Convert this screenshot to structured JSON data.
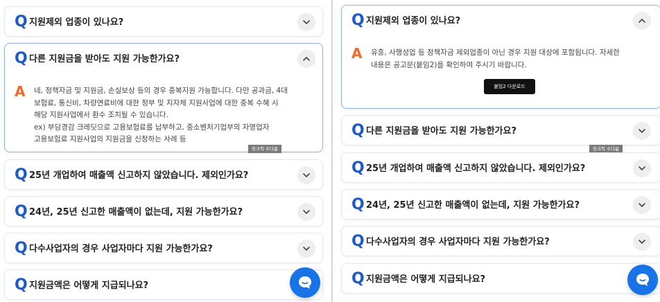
{
  "left_panel": {
    "items": [
      {
        "q": "Q",
        "question": "지원제외 업종이 있나요?",
        "open": false
      },
      {
        "q": "Q",
        "question": "다른 지원금을 받아도 지원 가능한가요?",
        "open": true,
        "a": "A",
        "answer_lines": [
          "네, 정책자금 및 지원금, 손실보상 등의 경우 중복지원 가능합니다. 다만 공과금, 4대",
          "보험료, 통신비, 차량연료비에 대한 정부 및 지자체 지원사업에 대한 중복 수혜 시",
          "해당 지원사업에서 환수 조치될 수 있습니다.",
          "ex) 부담경감 크레딧으로 고용보험료를 납부하고, 중소벤처기업부의 자영업자",
          "고용보험료 지원사업의 지원금을 신청하는 사례 등"
        ],
        "badge": "링크픽 수다름"
      },
      {
        "q": "Q",
        "question": "25년 개업하여 매출액 신고하지 않았습니다. 제외인가요?",
        "open": false
      },
      {
        "q": "Q",
        "question": "24년, 25년 신고한 매출액이 없는데, 지원 가능한가요?",
        "open": false
      },
      {
        "q": "Q",
        "question": "다수사업자의 경우 사업자마다 지원 가능한가요?",
        "open": false
      },
      {
        "q": "Q",
        "question": "지원금액은 어떻게 지급되나요?",
        "open": false
      }
    ]
  },
  "right_panel": {
    "items": [
      {
        "q": "Q",
        "question": "지원제외 업종이 있나요?",
        "open": true,
        "a": "A",
        "answer_lines": [
          "유흥, 사행성업 등 정책자금 제외업종이 아닌 경우 지원 대상에 포함됩니다. 자세한",
          "내용은 공고문(붙임2)을 확인하여 주시기 바랍니다."
        ],
        "button": "붙임2 다운로드"
      },
      {
        "q": "Q",
        "question": "다른 지원금을 받아도 지원 가능한가요?",
        "open": false
      },
      {
        "q": "Q",
        "question": "25년 개업하여 매출액 신고하지 않았습니다. 제외인가요?",
        "open": false
      },
      {
        "q": "Q",
        "question": "24년, 25년 신고한 매출액이 없는데, 지원 가능한가요?",
        "open": false
      },
      {
        "q": "Q",
        "question": "다수사업자의 경우 사업자마다 지원 가능한가요?",
        "open": false
      },
      {
        "q": "Q",
        "question": "지원금액은 어떻게 지급되나요?",
        "open": false
      }
    ],
    "badge": "링크픽 수다름"
  },
  "colors": {
    "q_blue": "#1f5bc4",
    "a_orange": "#ef6b2c",
    "chat_blue": "#1773e6"
  },
  "icons": {
    "expanded": "chevron-up-icon",
    "collapsed": "chevron-down-icon",
    "chat": "chat-bubble-icon"
  }
}
